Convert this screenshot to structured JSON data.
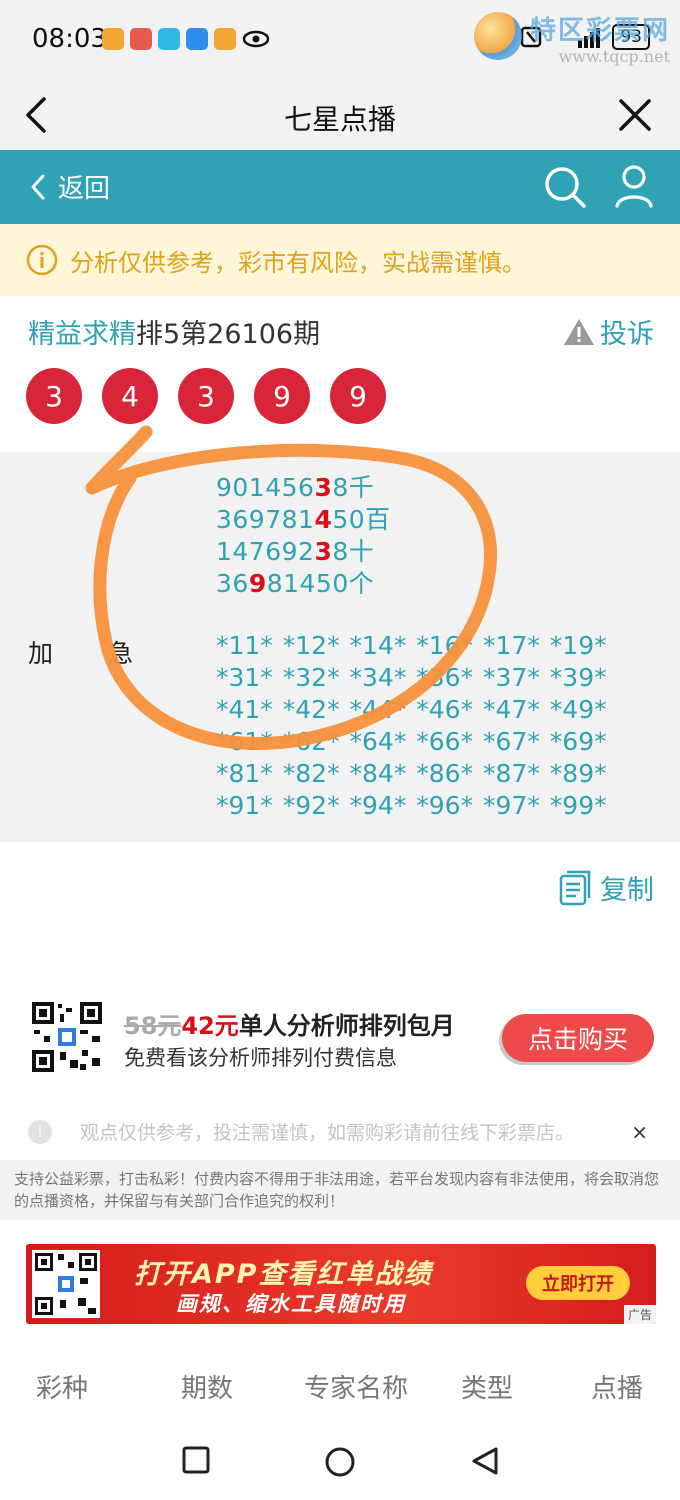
{
  "status_bar": {
    "time": "08:03",
    "battery": "93",
    "app_icons": [
      {
        "name": "app-icon-1",
        "color": "#f0a534"
      },
      {
        "name": "app-icon-2",
        "color": "#e65b4b"
      },
      {
        "name": "app-icon-3",
        "color": "#31b8e3"
      },
      {
        "name": "app-icon-4",
        "color": "#2e8de8"
      },
      {
        "name": "app-icon-5",
        "color": "#f0a534"
      }
    ]
  },
  "watermark": {
    "title": "特区彩票网",
    "url": "www.tqcp.net"
  },
  "nav": {
    "title": "七星点播"
  },
  "header": {
    "back_label": "返回",
    "accent": "#2fa2b6"
  },
  "notice": {
    "text": "分析仅供参考，彩市有风险，实战需谨慎。"
  },
  "post": {
    "analyst": "精益求精",
    "issue": "排5第26106期",
    "report_label": "投诉",
    "balls": [
      "3",
      "4",
      "3",
      "9",
      "9"
    ],
    "lines": [
      {
        "pre": "901456",
        "hl": "3",
        "post": "8千"
      },
      {
        "pre": "369781",
        "hl": "4",
        "post": "50百"
      },
      {
        "pre": "147692",
        "hl": "3",
        "post": "8十"
      },
      {
        "pre": "36",
        "hl": "9",
        "post": "81450个"
      }
    ],
    "side_label_a": "加",
    "side_label_b": "急",
    "combos": "*11* *12* *14* *16* *17* *19* *31* *32* *34* *36* *37* *39* *41* *42* *44* *46* *47* *49* *61* *62* *64* *66* *67* *69* *81* *82* *84* *86* *87* *89* *91* *92* *94* *96* *97* *99*",
    "copy_label": "复制"
  },
  "promo": {
    "old_price": "58元",
    "new_price": "42元",
    "title_rest": "单人分析师排列包月",
    "subtitle": "免费看该分析师排列付费信息",
    "buy_label": "点击购买"
  },
  "disclaimer": {
    "icon": "!",
    "text": "观点仅供参考，投注需谨慎，如需购彩请前往线下彩票店。",
    "close": "×"
  },
  "legal": {
    "text": "支持公益彩票，打击私彩！付费内容不得用于非法用途，若平台发现内容有非法使用，将会取消您的点播资格，并保留与有关部门合作追究的权利！"
  },
  "banner": {
    "line1": "打开APP查看红单战绩",
    "line2": "画规、缩水工具随时用",
    "button": "立即打开",
    "ad_tag": "广告"
  },
  "bottom_tabs": [
    "彩种",
    "期数",
    "专家名称",
    "类型",
    "点播"
  ]
}
